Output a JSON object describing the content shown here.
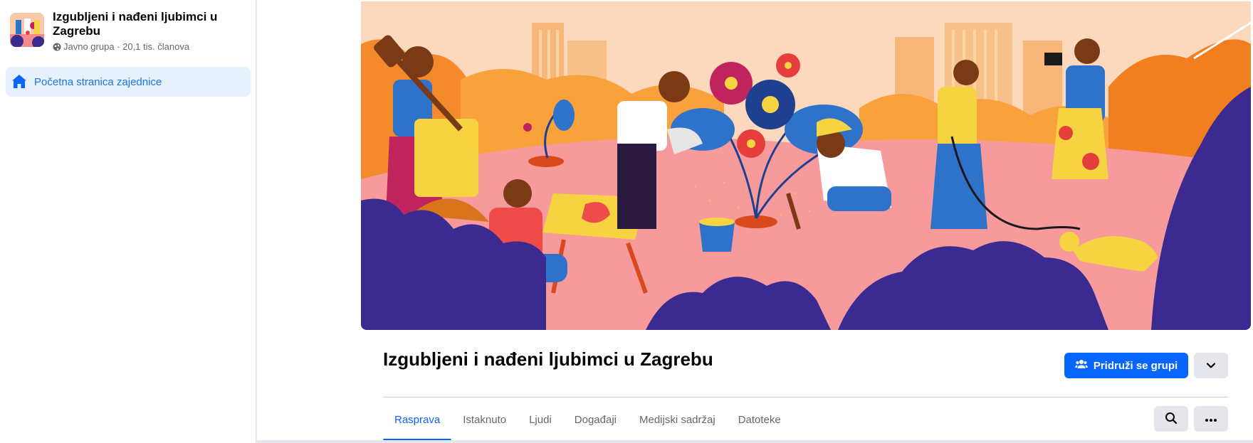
{
  "sidebar": {
    "group_name": "Izgubljeni i nađeni ljubimci u Zagrebu",
    "group_meta": "Javno grupa · 20,1 tis. članova",
    "nav_active_label": "Početna stranica zajednice",
    "globe_icon": "globe-icon",
    "home_icon": "home-icon"
  },
  "main": {
    "title": "Izgubljeni i nađeni ljubimci u Zagrebu",
    "join_label": "Pridruži se grupi",
    "join_icon": "people-icon",
    "more_icon": "chevron-down-icon",
    "tabs": [
      {
        "label": "Rasprava",
        "active": true
      },
      {
        "label": "Istaknuto",
        "active": false
      },
      {
        "label": "Ljudi",
        "active": false
      },
      {
        "label": "Događaji",
        "active": false
      },
      {
        "label": "Medijski sadržaj",
        "active": false
      },
      {
        "label": "Datoteke",
        "active": false
      }
    ],
    "search_icon": "search-icon",
    "options_icon": "ellipsis-icon"
  },
  "colors": {
    "accent": "#0866ff",
    "accent_soft": "#e7f0fd",
    "text_secondary": "#65676b",
    "button_gray": "#e4e6eb"
  }
}
